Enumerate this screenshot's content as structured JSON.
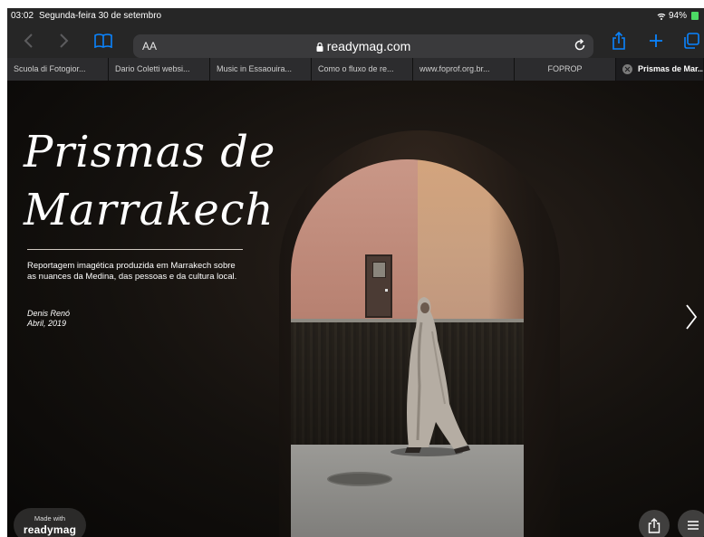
{
  "status_bar": {
    "time": "03:02",
    "date": "Segunda-feira 30 de setembro",
    "battery": "94%"
  },
  "toolbar": {
    "reader_label": "AA",
    "url": "readymag.com"
  },
  "tabs": [
    {
      "label": "Scuola di Fotogior..."
    },
    {
      "label": "Dario Coletti websi..."
    },
    {
      "label": "Music in Essaouira..."
    },
    {
      "label": "Como o fluxo de re..."
    },
    {
      "label": "www.foprof.org.br..."
    },
    {
      "label": "FOPROP"
    },
    {
      "label": "Prismas de Mar..."
    }
  ],
  "page": {
    "title_line1": "Prismas de",
    "title_line2": "Marrakech",
    "description": "Reportagem imagética produzida em Marrakech sobre as nuances da Medina, das pessoas e da cultura local.",
    "author": "Denis Renó",
    "date": "Abril, 2019",
    "made_with_small": "Made with",
    "made_with_brand": "readymag"
  },
  "icons": {
    "back": "chevron-left-icon",
    "forward": "chevron-right-icon",
    "bookmarks": "book-icon",
    "share": "share-icon",
    "new_tab": "plus-icon",
    "tabs": "tabs-icon",
    "next": "chevron-right-icon",
    "menu": "hamburger-icon"
  },
  "colors": {
    "accent": "#0a84ff",
    "chrome_bg": "#262626",
    "battery": "#4cd964"
  }
}
